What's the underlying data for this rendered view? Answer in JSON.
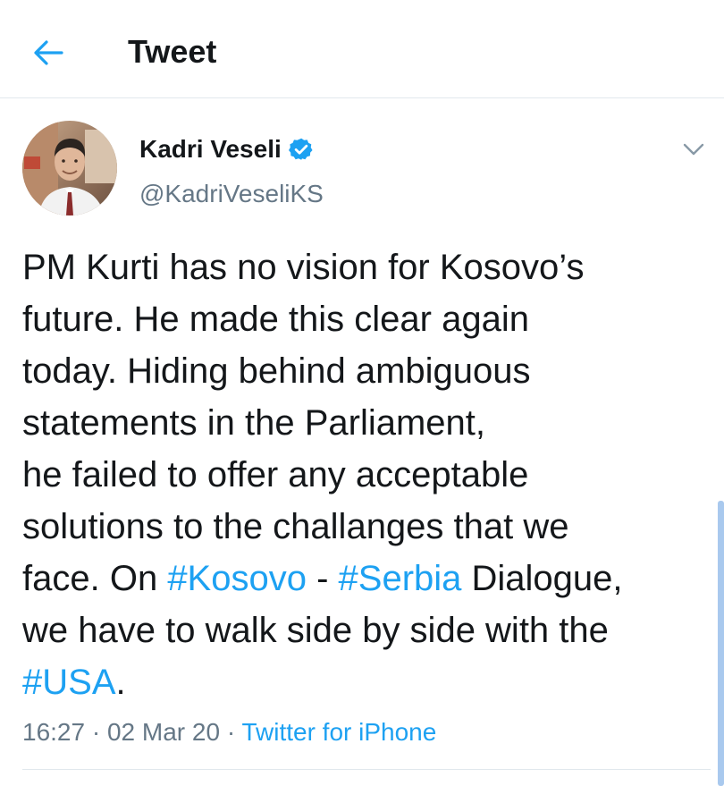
{
  "header": {
    "back_icon": "arrow-left-icon",
    "title": "Tweet"
  },
  "author": {
    "name": "Kadri Veseli",
    "handle": "@KadriVeseliKS",
    "verified": true,
    "avatar_icon": "profile-photo"
  },
  "tweet": {
    "lines": [
      [
        {
          "text": "PM Kurti has no vision for Kosovo’s"
        }
      ],
      [
        {
          "text": "future. He made this clear again"
        }
      ],
      [
        {
          "text": "today. Hiding behind ambiguous"
        }
      ],
      [
        {
          "text": "statements in the Parliament,"
        }
      ],
      [
        {
          "text": "he failed to offer any acceptable"
        }
      ],
      [
        {
          "text": "solutions to the challanges that we"
        }
      ],
      [
        {
          "text": "face. On "
        },
        {
          "text": "#Kosovo",
          "hashtag": true
        },
        {
          "text": " - "
        },
        {
          "text": "#Serbia",
          "hashtag": true
        },
        {
          "text": " Dialogue,"
        }
      ],
      [
        {
          "text": "we have to walk side by side with the"
        }
      ],
      [
        {
          "text": "#USA",
          "hashtag": true
        },
        {
          "text": "."
        }
      ]
    ]
  },
  "meta": {
    "time": "16:27",
    "separator": "·",
    "date": "02 Mar 20",
    "source": "Twitter for iPhone"
  },
  "colors": {
    "accent": "#1da1f2",
    "secondary_text": "#657786",
    "primary_text": "#14171a",
    "divider": "#e1e8ed"
  }
}
